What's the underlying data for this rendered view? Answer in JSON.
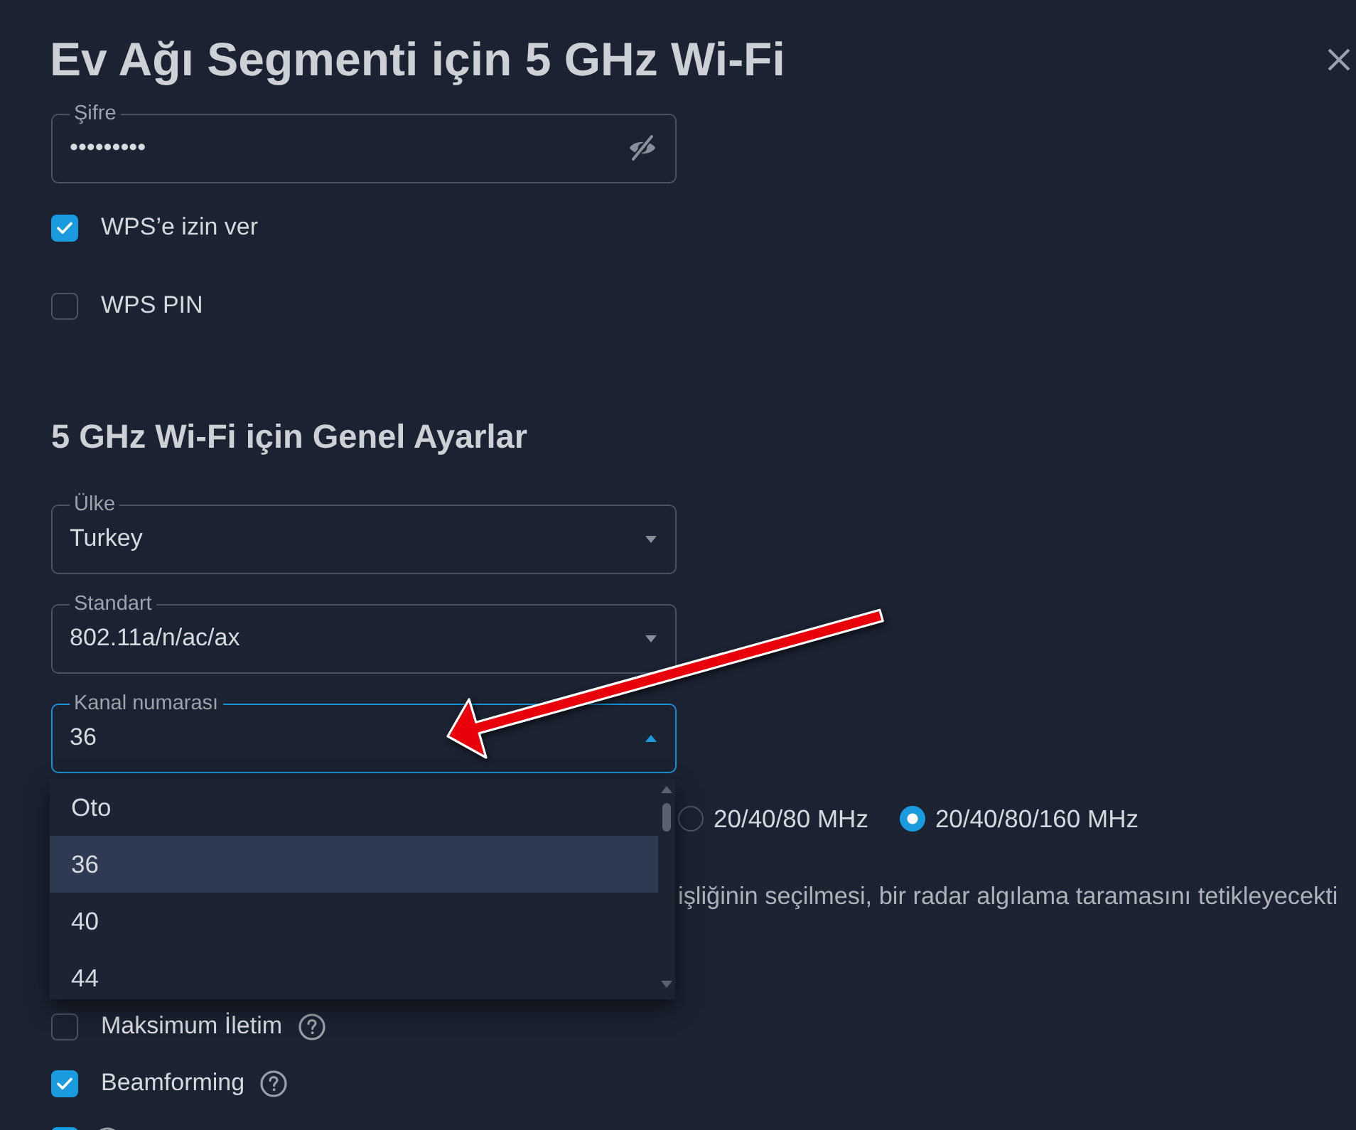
{
  "dialog": {
    "title": "Ev Ağı Segmenti için 5 GHz Wi-Fi"
  },
  "security": {
    "password": {
      "label": "Şifre",
      "value": "•••••••••",
      "visible": false
    },
    "options": [
      {
        "label": "WPS’e izin ver",
        "checked": true
      },
      {
        "label": "WPS PIN",
        "checked": false
      }
    ]
  },
  "general": {
    "heading": "5 GHz Wi-Fi için Genel Ayarlar",
    "selects": [
      {
        "label": "Ülke",
        "value": "Turkey",
        "expanded": false
      },
      {
        "label": "Standart",
        "value": "802.11a/n/ac/ax",
        "expanded": false
      },
      {
        "label": "Kanal numarası",
        "value": "36",
        "expanded": true,
        "options": [
          {
            "label": "Oto",
            "selected": false
          },
          {
            "label": "36",
            "selected": true
          },
          {
            "label": "40",
            "selected": false
          },
          {
            "label": "44",
            "selected": false
          }
        ]
      }
    ],
    "bandwidth": [
      {
        "label": "20/40/80 MHz",
        "selected": false
      },
      {
        "label": "20/40/80/160 MHz",
        "selected": true
      }
    ],
    "note": "işliğinin seçilmesi, bir radar algılama taramasını tetikleyecekti",
    "options": [
      {
        "label": "Maksimum İletim",
        "checked": false,
        "help": true
      },
      {
        "label": "Beamforming",
        "checked": true,
        "help": true
      },
      {
        "checked": true,
        "help": true
      }
    ]
  }
}
